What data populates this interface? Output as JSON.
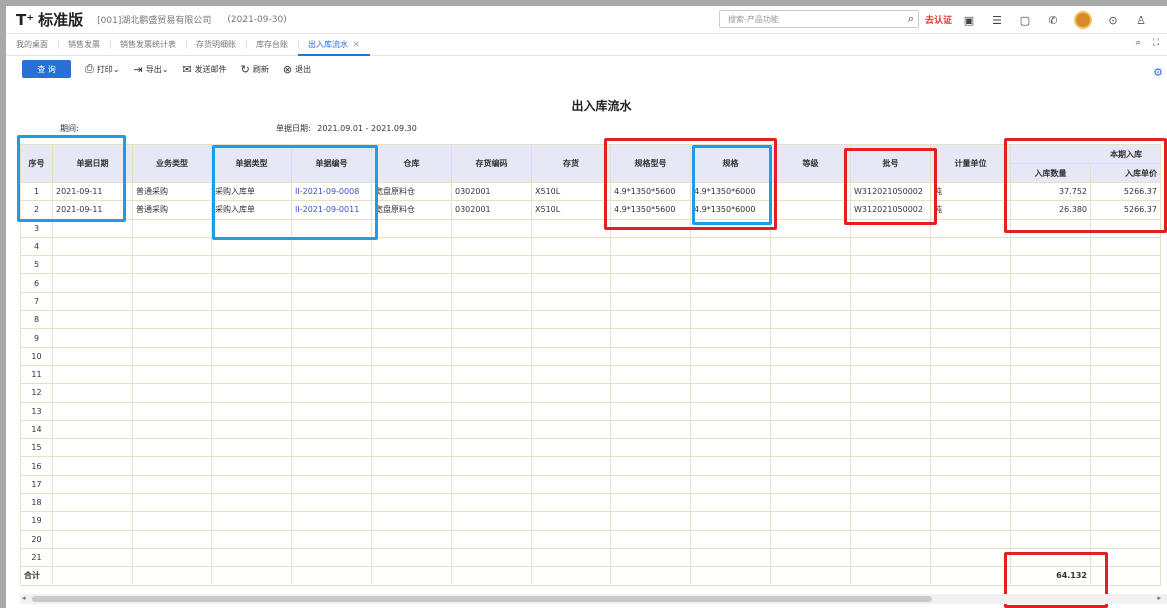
{
  "header": {
    "logo": "T⁺",
    "edition": "标准版",
    "company": "[001]湖北鹏盛贸易有限公司",
    "period": "(2021-09-30)",
    "search_placeholder": "搜索-产品功能",
    "cert": "去认证"
  },
  "tabs": [
    {
      "label": "我的桌面"
    },
    {
      "label": "销售发票"
    },
    {
      "label": "销售发票统计表"
    },
    {
      "label": "存货明细账"
    },
    {
      "label": "库存台账"
    },
    {
      "label": "出入库流水",
      "active": true
    }
  ],
  "toolbar": {
    "query": "查 询",
    "print": "打印",
    "export": "导出",
    "email": "发送邮件",
    "refresh": "刷新",
    "exit": "退出"
  },
  "report": {
    "title": "出入库流水",
    "period_label": "期间:",
    "date_label": "单据日期:",
    "date_range": "2021.09.01 - 2021.09.30"
  },
  "table": {
    "columns": [
      "序号",
      "单据日期",
      "业务类型",
      "单据类型",
      "单据编号",
      "仓库",
      "存货编码",
      "存货",
      "规格型号",
      "规格",
      "等级",
      "批号",
      "计量单位"
    ],
    "group_header": "本期入库",
    "sub_columns": [
      "入库数量",
      "入库单价"
    ],
    "rows": [
      {
        "seq": "1",
        "date": "2021-09-11",
        "biz": "普通采购",
        "doctype": "采购入库单",
        "docno": "II-2021-09-0008",
        "wh": "宽盘原料仓",
        "code": "0302001",
        "item": "X510L",
        "model": "4.9*1350*5600",
        "spec": "4.9*1350*6000",
        "grade": "",
        "batch": "W312021050002",
        "unit": "吨",
        "qty": "37.752",
        "price": "5266.37"
      },
      {
        "seq": "2",
        "date": "2021-09-11",
        "biz": "普通采购",
        "doctype": "采购入库单",
        "docno": "II-2021-09-0011",
        "wh": "宽盘原料仓",
        "code": "0302001",
        "item": "X510L",
        "model": "4.9*1350*5600",
        "spec": "4.9*1350*6000",
        "grade": "",
        "batch": "W312021050002",
        "unit": "吨",
        "qty": "26.380",
        "price": "5266.37"
      }
    ],
    "empty_seq": [
      "3",
      "4",
      "5",
      "6",
      "7",
      "8",
      "9",
      "10",
      "11",
      "12",
      "13",
      "14",
      "15",
      "16",
      "17",
      "18",
      "19",
      "20",
      "21"
    ],
    "total_label": "合计",
    "total_qty": "64.132"
  },
  "colors": {
    "accent": "#2a6fd6",
    "header_bg": "#e6e8f5",
    "highlight_blue": "#1e9ce8",
    "highlight_red": "#e32020"
  }
}
